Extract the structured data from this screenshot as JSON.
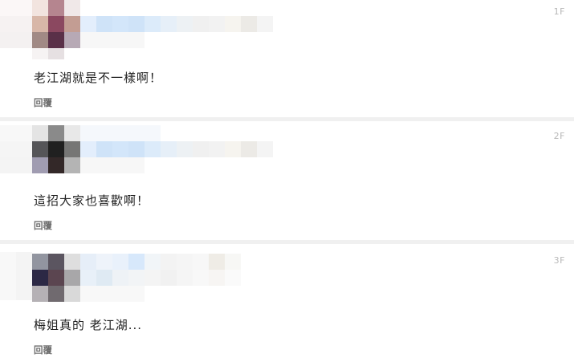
{
  "comments": [
    {
      "floor": "1F",
      "text": "老江湖就是不一樣啊！",
      "reply_label": "回覆"
    },
    {
      "floor": "2F",
      "text": "這招大家也喜歡啊！",
      "reply_label": "回覆"
    },
    {
      "floor": "3F",
      "text": "梅姐真的 老江湖...",
      "reply_label": "回覆"
    }
  ],
  "mosaic_colors": {
    "avatar1": [
      "#f2e4df",
      "#b5858f",
      "#f0e8e8",
      "#d8b7a8",
      "#8b4860",
      "#c39d93",
      "#a18a85",
      "#5a3048",
      "#b7a9b5"
    ],
    "avatar2": [
      "#e4e4e4",
      "#8a8a8a",
      "#e8e8e8",
      "#555558",
      "#202020",
      "#767675",
      "#a09cb1",
      "#332828",
      "#b4b4b4"
    ],
    "avatar3": [
      "#fafafa",
      "#9295a0",
      "#5b5560",
      "#dedede",
      "#2c2845",
      "#5b4550",
      "#a8a7a9",
      "#d9d9d9",
      "#706a6f",
      "#b5b1b5"
    ],
    "name_strip": [
      "#e3eefc",
      "#cfe3f8",
      "#dcebfa",
      "#e6eff8",
      "#edf1f4",
      "#f0f0f0",
      "#f6f4ef",
      "#eceae6"
    ]
  }
}
